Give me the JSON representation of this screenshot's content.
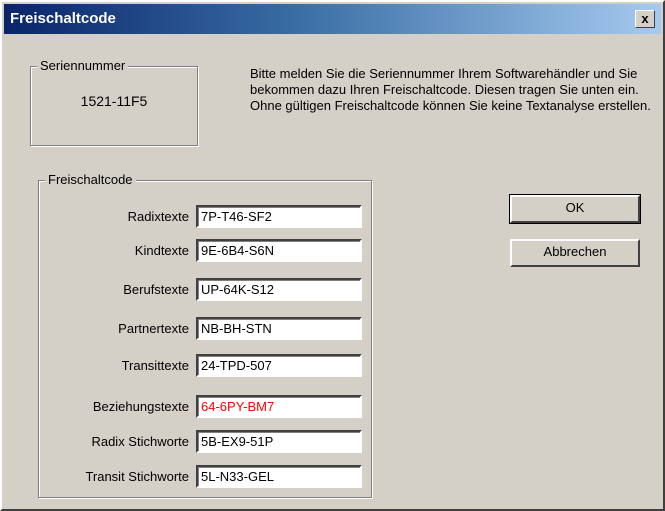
{
  "window": {
    "title": "Freischaltcode",
    "close_label": "x"
  },
  "serial": {
    "legend": "Seriennummer",
    "value": "1521-11F5"
  },
  "info_text": "Bitte melden Sie die Seriennummer Ihrem Softwarehändler und Sie bekommen dazu Ihren Freischaltcode. Diesen tragen Sie unten ein. Ohne gültigen Freischaltcode können Sie keine Textanalyse erstellen.",
  "codes": {
    "legend": "Freischaltcode",
    "rows": [
      {
        "label": "Radixtexte",
        "value": "7P-T46-SF2",
        "color": "#000000"
      },
      {
        "label": "Kindtexte",
        "value": "9E-6B4-S6N",
        "color": "#000000"
      },
      {
        "label": "Berufstexte",
        "value": "UP-64K-S12",
        "color": "#000000"
      },
      {
        "label": "Partnertexte",
        "value": "NB-BH-STN",
        "color": "#000000"
      },
      {
        "label": "Transittexte",
        "value": "24-TPD-507",
        "color": "#000000"
      },
      {
        "label": "Beziehungstexte",
        "value": "64-6PY-BM7",
        "color": "#ff0000"
      },
      {
        "label": "Radix Stichworte",
        "value": "5B-EX9-51P",
        "color": "#000000"
      },
      {
        "label": "Transit Stichworte",
        "value": "5L-N33-GEL",
        "color": "#000000"
      }
    ]
  },
  "buttons": {
    "ok": "OK",
    "cancel": "Abbrechen"
  }
}
